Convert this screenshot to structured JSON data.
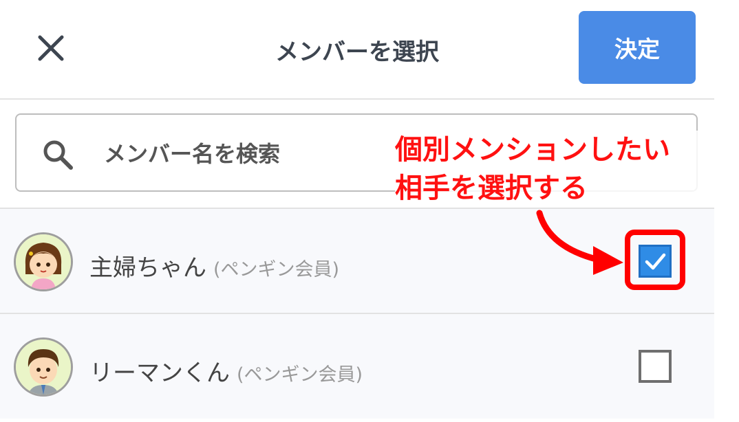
{
  "header": {
    "title": "メンバーを選択",
    "confirm_label": "決定"
  },
  "search": {
    "placeholder": "メンバー名を検索"
  },
  "members": [
    {
      "name": "主婦ちゃん",
      "role": "(ペンギン会員)",
      "checked": true
    },
    {
      "name": "リーマンくん",
      "role": "(ペンギン会員)",
      "checked": false
    }
  ],
  "annotation": {
    "line1": "個別メンションしたい",
    "line2": "相手を選択する"
  },
  "colors": {
    "accent": "#4a8be6",
    "checkbox_checked": "#2f8ce6",
    "annotation": "#ff0000"
  },
  "icons": {
    "close": "close-icon",
    "search": "search-icon",
    "check": "check-icon"
  }
}
